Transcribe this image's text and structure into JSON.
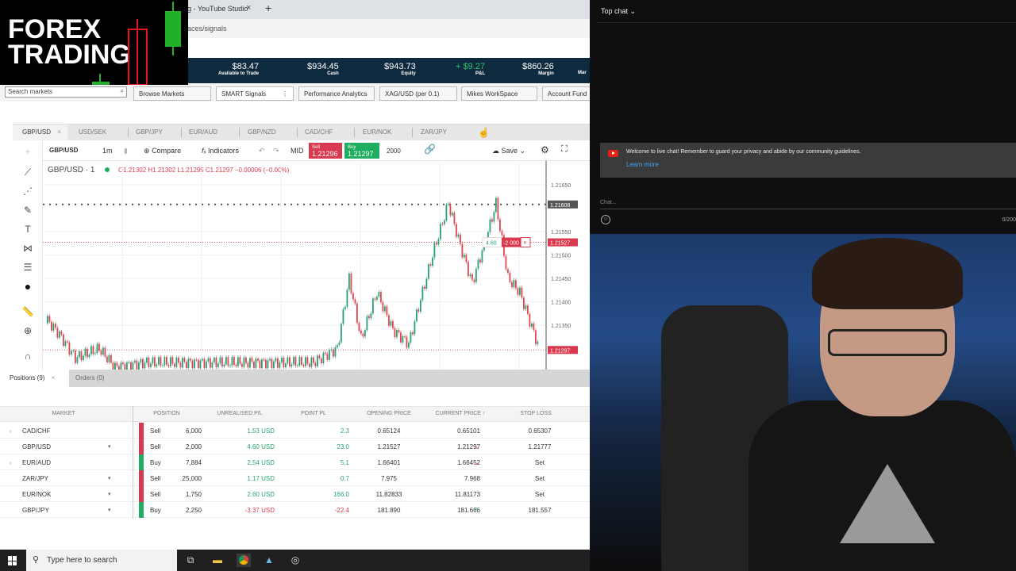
{
  "overlay": {
    "logo_line1": "FOREX",
    "logo_line2": "TRADING"
  },
  "browser": {
    "tab_title": "g - YouTube Studio",
    "tab_close": "×",
    "new_tab": "+",
    "url": "aces/signals"
  },
  "account": {
    "stats": [
      {
        "value": "$83.47",
        "label": "Available to Trade"
      },
      {
        "value": "$934.45",
        "label": "Cash"
      },
      {
        "value": "$943.73",
        "label": "Equity"
      },
      {
        "value": "+ $9.27",
        "label": "P&L"
      },
      {
        "value": "$860.26",
        "label": "Margin"
      },
      {
        "value": "",
        "label": "Mar"
      }
    ]
  },
  "workspace": {
    "search_placeholder": "Search markets",
    "tabs": [
      "Browse Markets",
      "SMART Signals",
      "Performance Analytics",
      "XAG/USD (per 0.1)",
      "Mikes WorkSpace",
      "Account Fund"
    ],
    "active_tab": "SMART Signals"
  },
  "chart": {
    "pair_tabs": [
      "GBP/USD",
      "USD/SEK",
      "GBP/JPY",
      "EUR/AUD",
      "GBP/NZD",
      "CAD/CHF",
      "EUR/NOK",
      "ZAR/JPY"
    ],
    "active_pair": "GBP/USD",
    "toolbar": {
      "symbol": "GBP/USD",
      "interval": "1m",
      "compare": "Compare",
      "indicators": "Indicators",
      "mid": "MID",
      "sell_label": "Sell",
      "sell_price": "1.21296",
      "buy_label": "Buy",
      "buy_price": "1.21297",
      "quantity": "2000",
      "save": "Save"
    },
    "legend": {
      "title": "GBP/USD · 1",
      "ohlc": "O1.21302 H1.21302 L1.21295 C1.21297 −0.00006 (−0.00%)"
    },
    "price_axis": [
      "1.21650",
      "1.21550",
      "1.21500",
      "1.21450",
      "1.21400",
      "1.21350"
    ],
    "markers": {
      "high_line": "1.21608",
      "entry_line": "1.21527",
      "current_line": "1.21297"
    },
    "order_tag": {
      "pl": "4.60",
      "qty": "-2 000",
      "close": "×"
    }
  },
  "positions": {
    "tabs": [
      "Positions (9)",
      "Orders (0)"
    ],
    "tab_close": "×",
    "columns": [
      "MARKET",
      "POSITION",
      "UNREALISED P/L",
      "POINT PL",
      "OPENING PRICE",
      "CURRENT PRICE ↑",
      "STOP LOSS"
    ],
    "rows": [
      {
        "expander": "›",
        "market": "CAD/CHF",
        "caret": "",
        "side": "Sell",
        "size": "6,000",
        "upl": "1.53 USD",
        "point_pl": "2.3",
        "open": "0.65124",
        "current": "0.65101",
        "trend": "",
        "stop": "0.65307",
        "positive": true
      },
      {
        "expander": "",
        "market": "GBP/USD",
        "caret": "▾",
        "side": "Sell",
        "size": "2,000",
        "upl": "4.60 USD",
        "point_pl": "23.0",
        "open": "1.21527",
        "current": "1.21297",
        "trend": "⌄",
        "stop": "1.21777",
        "positive": true
      },
      {
        "expander": "›",
        "market": "EUR/AUD",
        "caret": "",
        "side": "Buy",
        "size": "7,884",
        "upl": "2.54 USD",
        "point_pl": "5.1",
        "open": "1.66401",
        "current": "1.66452",
        "trend": "⌄",
        "stop": "Set",
        "positive": true
      },
      {
        "expander": "",
        "market": "ZAR/JPY",
        "caret": "▾",
        "side": "Sell",
        "size": "25,000",
        "upl": "1.17 USD",
        "point_pl": "0.7",
        "open": "7.975",
        "current": "7.968",
        "trend": "",
        "stop": "Set",
        "positive": true
      },
      {
        "expander": "",
        "market": "EUR/NOK",
        "caret": "▾",
        "side": "Sell",
        "size": "1,750",
        "upl": "2.60 USD",
        "point_pl": "166.0",
        "open": "11.82833",
        "current": "11.81173",
        "trend": "",
        "stop": "Set",
        "positive": true
      },
      {
        "expander": "",
        "market": "GBP/JPY",
        "caret": "▾",
        "side": "Buy",
        "size": "2,250",
        "upl": "-3.37 USD",
        "point_pl": "-22.4",
        "open": "181.890",
        "current": "181.666",
        "trend": "^",
        "stop": "181.557",
        "positive": false
      }
    ]
  },
  "chat": {
    "header": "Top chat",
    "welcome": "Welcome to live chat! Remember to guard your privacy and abide by our community guidelines.",
    "learn_more": "Learn more",
    "input_placeholder": "Chat...",
    "char_count": "0/200"
  },
  "taskbar": {
    "search_placeholder": "Type here to search"
  },
  "colors": {
    "sell": "#d9394e",
    "buy": "#1fae5f",
    "account_bar": "#0e2a3f",
    "chat_bg": "#0f0f0f",
    "link": "#3ea6ff"
  }
}
